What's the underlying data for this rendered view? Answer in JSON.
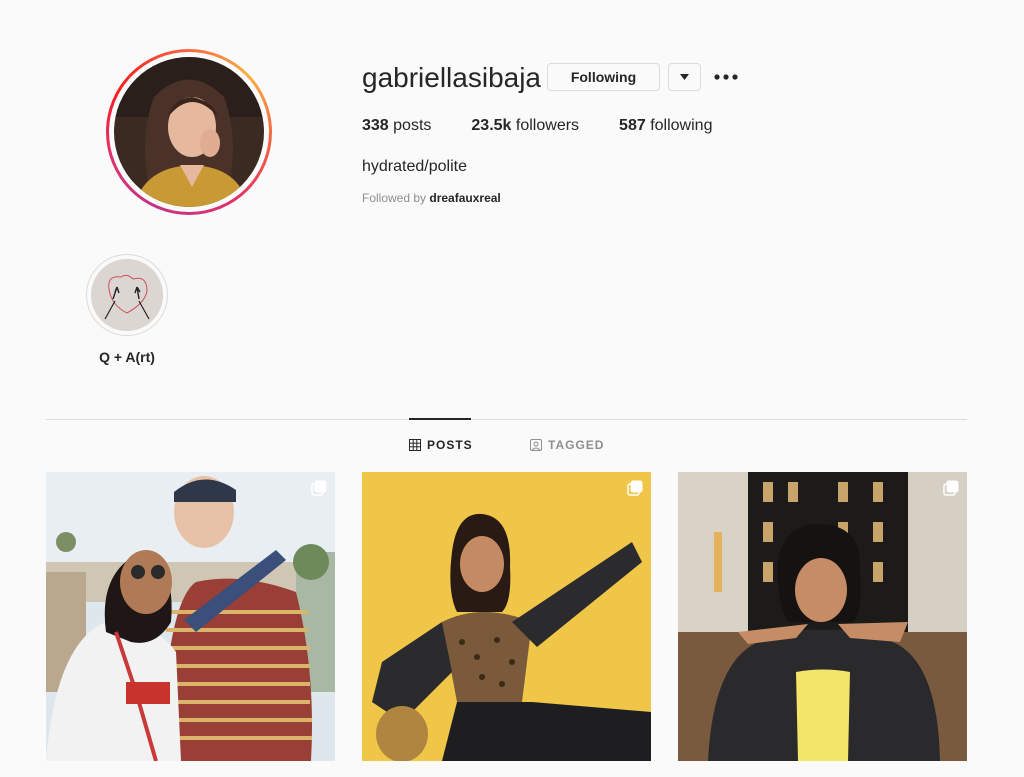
{
  "profile": {
    "username": "gabriellasibaja",
    "following_button": "Following",
    "stats": {
      "posts_count": "338",
      "posts_label": "posts",
      "followers_count": "23.5k",
      "followers_label": "followers",
      "following_count": "587",
      "following_label": "following"
    },
    "bio": "hydrated/polite",
    "followed_by_prefix": "Followed by",
    "followed_by_user": "dreafauxreal"
  },
  "highlights": [
    {
      "label": "Q + A(rt)"
    }
  ],
  "tabs": {
    "posts": "POSTS",
    "tagged": "TAGGED"
  },
  "posts": [
    {
      "description": "couple-selfie-at-festival",
      "multi": true
    },
    {
      "description": "woman-posing-yellow-wall",
      "multi": true
    },
    {
      "description": "woman-smiling-denim-jacket",
      "multi": true
    }
  ],
  "colors": {
    "text": "#262626",
    "secondary": "#8e8e8e",
    "border": "#dbdbdb",
    "background": "#fafafa"
  }
}
